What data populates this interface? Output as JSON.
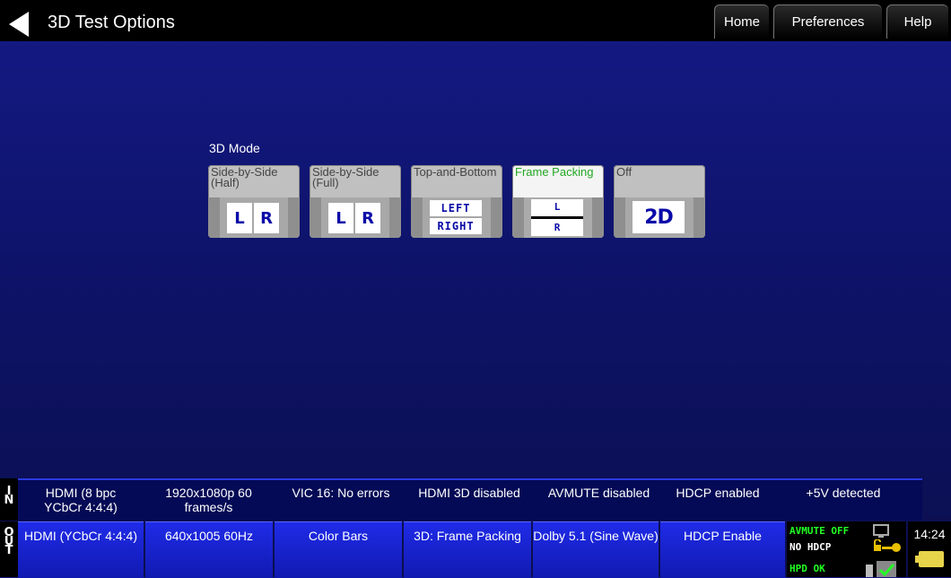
{
  "header": {
    "title": "3D Test Options",
    "nav": [
      "Home",
      "Preferences",
      "Help"
    ]
  },
  "mode": {
    "label": "3D Mode",
    "options": [
      {
        "label": "Side-by-Side (Half)",
        "icon_text": [
          "L",
          "R"
        ]
      },
      {
        "label": "Side-by-Side (Full)",
        "icon_text": [
          "L",
          "R"
        ]
      },
      {
        "label": "Top-and-Bottom",
        "icon_text": [
          "LEFT",
          "RIGHT"
        ]
      },
      {
        "label": "Frame Packing",
        "icon_text": [
          "L",
          "R"
        ],
        "selected": true
      },
      {
        "label": "Off",
        "icon_text": [
          "2D"
        ]
      }
    ]
  },
  "input_status": {
    "io_label": "IN",
    "cells": [
      "HDMI (8 bpc YCbCr 4:4:4)",
      "1920x1080p 60 frames/s",
      "VIC 16: No errors",
      "HDMI 3D disabled",
      "AVMUTE disabled",
      "HDCP enabled",
      "+5V detected"
    ]
  },
  "output_status": {
    "io_label": "OUT",
    "buttons": [
      "HDMI (YCbCr 4:4:4)",
      "640x1005 60Hz",
      "Color Bars",
      "3D: Frame Packing",
      "Dolby 5.1 (Sine Wave)",
      "HDCP Enable"
    ]
  },
  "status_panel": {
    "avmute": "AVMUTE OFF",
    "hdcp": "NO HDCP",
    "hpd": "HPD OK"
  },
  "clock": "14:24",
  "colors": {
    "accent_green": "#22a722",
    "status_green": "#22ff22",
    "button_blue": "#1f2be8"
  }
}
